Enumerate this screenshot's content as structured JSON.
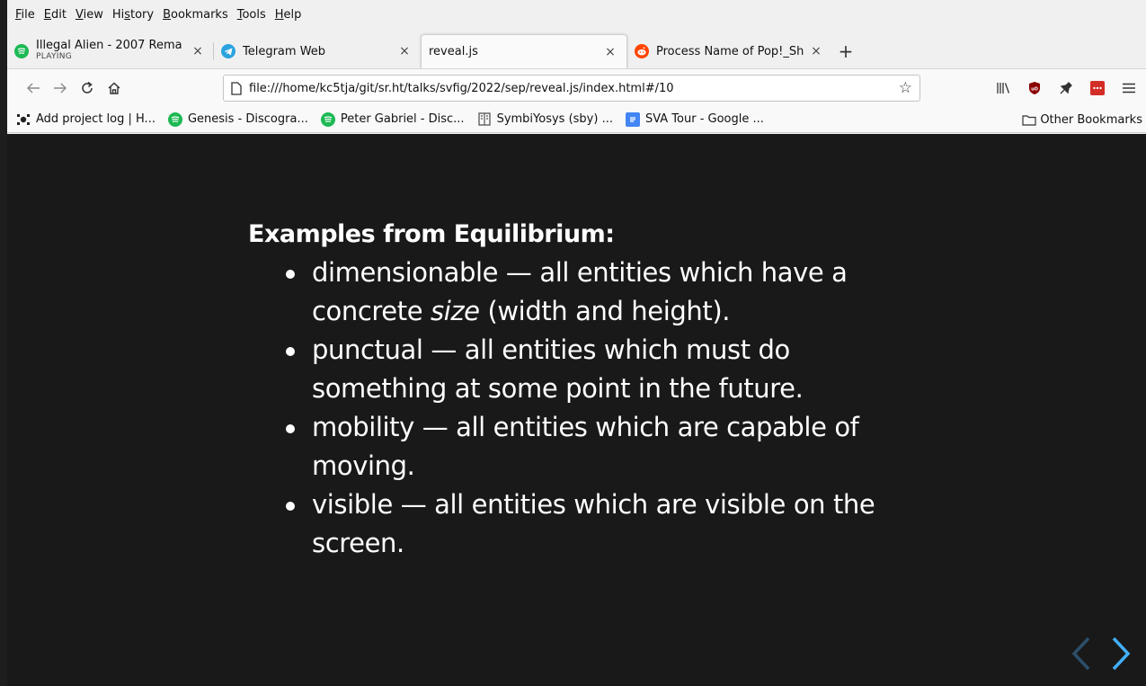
{
  "menubar": {
    "items": [
      {
        "u": "F",
        "rest": "ile"
      },
      {
        "u": "E",
        "rest": "dit"
      },
      {
        "u": "V",
        "rest": "iew"
      },
      {
        "pre": "Hi",
        "u": "s",
        "rest": "tory"
      },
      {
        "u": "B",
        "rest": "ookmarks"
      },
      {
        "u": "T",
        "rest": "ools"
      },
      {
        "u": "H",
        "rest": "elp"
      }
    ]
  },
  "tabs": [
    {
      "title": "Illegal Alien - 2007 Rema",
      "subtitle": "PLAYING",
      "close": "×",
      "icon": "spotify-icon",
      "color": "#1db954"
    },
    {
      "title": "Telegram Web",
      "close": "×",
      "icon": "telegram-icon",
      "color": "#2aa3e0"
    },
    {
      "title": "reveal.js",
      "close": "×",
      "active": true
    },
    {
      "title": "Process Name of Pop!_Sh",
      "close": "×",
      "icon": "reddit-icon",
      "color": "#ff4500"
    }
  ],
  "newtab_label": "+",
  "nav": {
    "url": "file:///home/kc5tja/git/sr.ht/talks/svfig/2022/sep/reveal.js/index.html#/10"
  },
  "bookmarks": [
    {
      "label": "Add project log | H...",
      "icon": "hackaday-icon",
      "color": "#222222"
    },
    {
      "label": "Genesis - Discogra...",
      "icon": "spotify-icon",
      "color": "#1db954"
    },
    {
      "label": "Peter Gabriel - Disc...",
      "icon": "spotify-icon",
      "color": "#1db954"
    },
    {
      "label": "SymbiYosys (sby) ...",
      "icon": "book-icon",
      "color": "#555555"
    },
    {
      "label": "SVA Tour - Google ...",
      "icon": "google-docs-icon",
      "color": "#4285f4"
    }
  ],
  "other_bookmarks": "Other Bookmarks",
  "slide": {
    "heading": "Examples from Equilibrium:",
    "items": [
      {
        "term": "dimensionable",
        "desc_pre": " — all entities which have a concrete ",
        "desc_em": "size",
        "desc_post": " (width and height)."
      },
      {
        "term": "punctual",
        "desc_pre": " — all entities which must do something at some point in the future.",
        "desc_em": "",
        "desc_post": ""
      },
      {
        "term": "mobility",
        "desc_pre": " — all entities which are capable of moving.",
        "desc_em": "",
        "desc_post": ""
      },
      {
        "term": "visible",
        "desc_pre": " — all entities which are visible on the screen.",
        "desc_em": "",
        "desc_post": ""
      }
    ]
  },
  "colors": {
    "slide_bg": "#191919",
    "control_active": "#42affa",
    "control_dim": "#2c4f6b"
  }
}
